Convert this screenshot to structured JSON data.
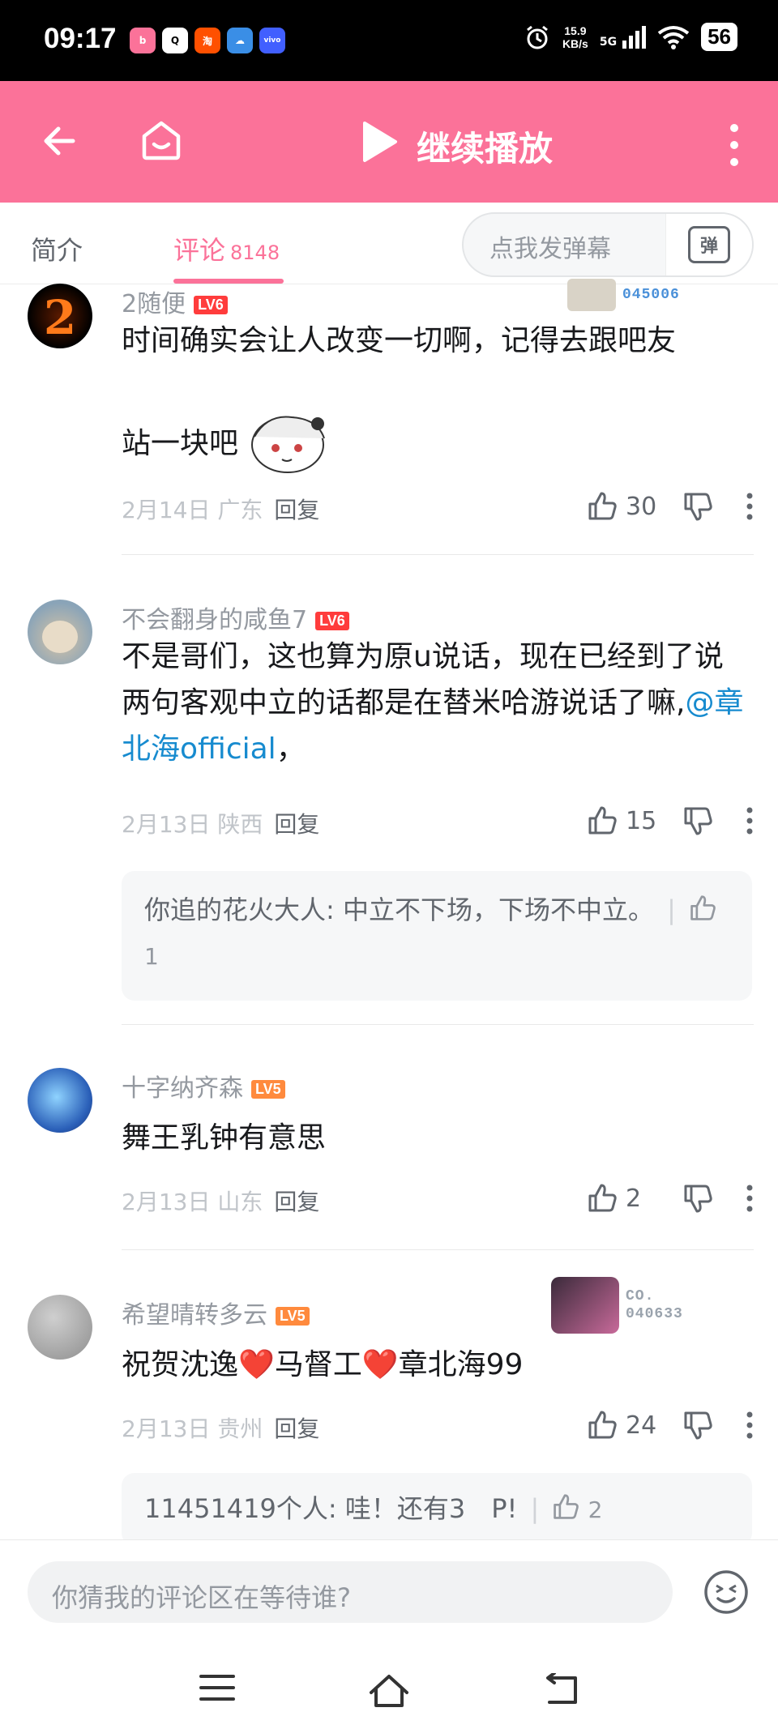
{
  "status_bar": {
    "time": "09:17",
    "apps": [
      "bilibili",
      "qq",
      "taobao",
      "cloud",
      "vivo"
    ],
    "speed_value": "15.9",
    "speed_unit": "KB/s",
    "network": "5G",
    "battery": "56"
  },
  "header": {
    "title": "继续播放",
    "icons": [
      "back-arrow-icon",
      "home-icon",
      "play-icon",
      "more-vertical-icon"
    ],
    "color": "#fb7299"
  },
  "tabs": {
    "intro": "简介",
    "comments": "评论",
    "comments_count": "8148",
    "danmaku_placeholder": "点我发弹幕",
    "danmaku_button": "弹"
  },
  "comments": [
    {
      "username": "2随便",
      "level": "LV6",
      "text_line1": "时间确实会让人改变一切啊，记得去跟吧友",
      "text_line2": "站一块吧",
      "date": "2月14日",
      "location": "广东",
      "reply_label": "回复",
      "likes": "30",
      "badge_number": "045006"
    },
    {
      "username": "不会翻身的咸鱼7",
      "level": "LV6",
      "text": "不是哥们，这也算为原u说话，现在已经到了说两句客观中立的话都是在替米哈游说话了嘛,",
      "mention": "@章北海official",
      "text_tail": "，",
      "date": "2月13日",
      "location": "陕西",
      "reply_label": "回复",
      "likes": "15",
      "sub_reply": {
        "text": "你追的花火大人: 中立不下场，下场不中立。",
        "likes": "1"
      }
    },
    {
      "username": "十字纳齐森",
      "level": "LV5",
      "text": "舞王乳钟有意思",
      "date": "2月13日",
      "location": "山东",
      "reply_label": "回复",
      "likes": "2"
    },
    {
      "username": "希望晴转多云",
      "level": "LV5",
      "text": "祝贺沈逸❤️马督工❤️章北海99",
      "date": "2月13日",
      "location": "贵州",
      "reply_label": "回复",
      "likes": "24",
      "badge_label": "CO.",
      "badge_number": "040633",
      "sub_reply": {
        "text": "11451419个人: 哇！还有3　P!",
        "likes": "2"
      }
    }
  ],
  "bottom": {
    "input_placeholder": "你猜我的评论区在等待谁?",
    "emoji_icon": "emoji-icon",
    "nav_icons": [
      "menu-icon",
      "home-icon",
      "back-icon"
    ]
  }
}
